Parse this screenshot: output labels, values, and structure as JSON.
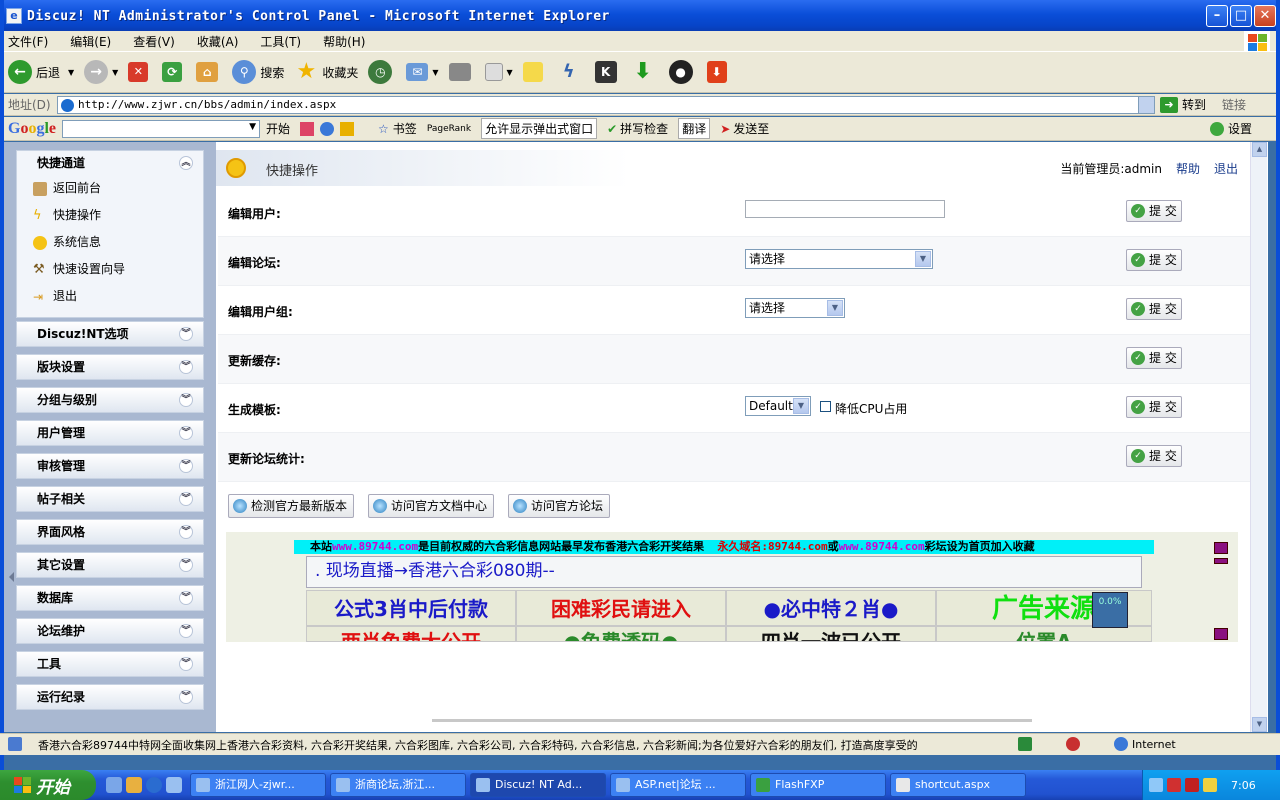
{
  "window": {
    "title": "Discuz! NT Administrator's Control Panel - Microsoft Internet Explorer"
  },
  "menubar": [
    "文件(F)",
    "编辑(E)",
    "查看(V)",
    "收藏(A)",
    "工具(T)",
    "帮助(H)"
  ],
  "toolbar": {
    "back": "后退",
    "search": "搜索",
    "favorites": "收藏夹"
  },
  "address": {
    "label": "地址(D)",
    "url": "http://www.zjwr.cn/bbs/admin/index.aspx",
    "go": "转到",
    "links": "链接"
  },
  "googlebar": {
    "logo": "Google",
    "go": "开始",
    "bookmarks": "书签",
    "pagerank": "PageRank",
    "popup": "允许显示弹出式窗口",
    "spell": "拼写检查",
    "translate": "翻译",
    "sendto": "发送至",
    "settings": "设置"
  },
  "sidebar": {
    "quick": {
      "title": "快捷通道",
      "items": [
        "返回前台",
        "快捷操作",
        "系统信息",
        "快速设置向导",
        "退出"
      ]
    },
    "groups": [
      "Discuz!NT选项",
      "版块设置",
      "分组与级别",
      "用户管理",
      "审核管理",
      "帖子相关",
      "界面风格",
      "其它设置",
      "数据库",
      "论坛维护",
      "工具",
      "运行纪录"
    ]
  },
  "panel": {
    "title": "快捷操作",
    "admin_label": "当前管理员:admin",
    "help": "帮助",
    "logout": "退出",
    "rows": [
      {
        "label": "编辑用户:"
      },
      {
        "label": "编辑论坛:",
        "select": "请选择"
      },
      {
        "label": "编辑用户组:",
        "select": "请选择"
      },
      {
        "label": "更新缓存:"
      },
      {
        "label": "生成模板:",
        "select": "Default",
        "check": "降低CPU占用"
      },
      {
        "label": "更新论坛统计:"
      }
    ],
    "submit": "提 交",
    "buttons": [
      "检测官方最新版本",
      "访问官方文档中心",
      "访问官方论坛"
    ]
  },
  "ad": {
    "banner_a": "本站",
    "banner_url1": "www.89744.com",
    "banner_b": "是目前权威的六合彩信息网站最早发布香港六合彩开奖结果",
    "banner_c": "永久域名:89744.com",
    "banner_d": "或",
    "banner_url2": "www.89744.com",
    "banner_e": "彩坛设为首页加入收藏",
    "scroll": ". 现场直播→香港六合彩080期--",
    "cells": [
      "公式3肖中后付款",
      "困难彩民请进入",
      "●必中特２肖●",
      "广告来源"
    ],
    "cells2": [
      "两肖免费大公开",
      "●免费透码●",
      "四肖一波已公开",
      "位置A"
    ],
    "pct": "0.0%",
    "colors": {
      "blue": "#1a1ac8",
      "red": "#e01010",
      "green": "#10e010"
    }
  },
  "status": {
    "msg": "香港六合彩89744中特网全面收集网上香港六合彩资料, 六合彩开奖结果, 六合彩图库, 六合彩公司, 六合彩特码, 六合彩信息, 六合彩新闻;为各位爱好六合彩的朋友们, 打造高度享受的",
    "zone": "Internet"
  },
  "taskbar": {
    "start": "开始",
    "tasks": [
      "浙江网人-zjwr...",
      "浙商论坛,浙江...",
      "Discuz! NT Ad...",
      "ASP.net|论坛 ...",
      "FlashFXP",
      "shortcut.aspx"
    ],
    "time": "7:06"
  }
}
